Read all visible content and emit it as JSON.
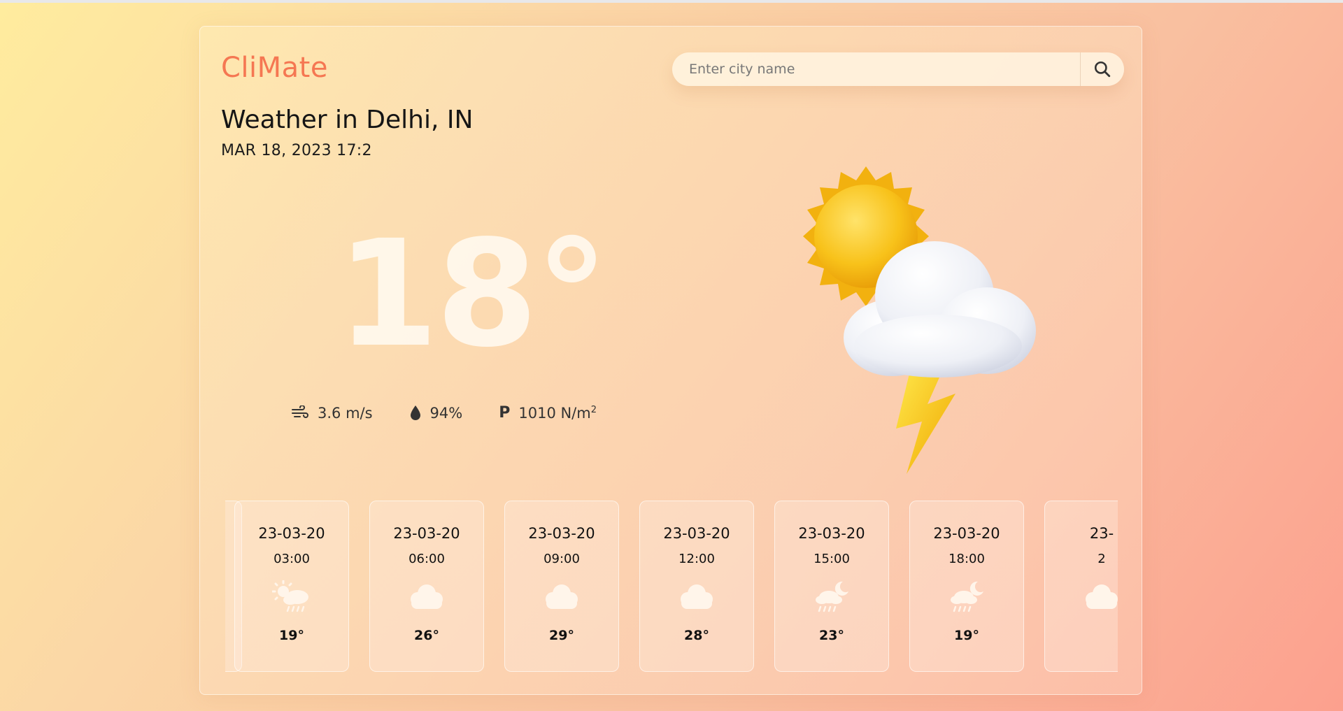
{
  "app": {
    "logo": "CliMate"
  },
  "search": {
    "placeholder": "Enter city name"
  },
  "weather": {
    "title": "Weather in Delhi, IN",
    "datetime": "MAR 18, 2023 17:2",
    "temperature": "18°",
    "wind": "3.6 m/s",
    "humidity": "94%",
    "pressure_prefix": "P",
    "pressure_value": "1010 N/m",
    "pressure_exp": "2",
    "condition_icon": "sun-cloud-thunder-icon"
  },
  "forecast": [
    {
      "date": "23-03-20",
      "time": "03:00",
      "temp": "19°",
      "icon": "sun-rain-icon"
    },
    {
      "date": "23-03-20",
      "time": "06:00",
      "temp": "26°",
      "icon": "cloud-icon"
    },
    {
      "date": "23-03-20",
      "time": "09:00",
      "temp": "29°",
      "icon": "cloud-icon"
    },
    {
      "date": "23-03-20",
      "time": "12:00",
      "temp": "28°",
      "icon": "cloud-icon"
    },
    {
      "date": "23-03-20",
      "time": "15:00",
      "temp": "23°",
      "icon": "moon-rain-icon"
    },
    {
      "date": "23-03-20",
      "time": "18:00",
      "temp": "19°",
      "icon": "moon-rain-icon"
    },
    {
      "date": "23-",
      "time": "2",
      "temp": "",
      "icon": "cloud-icon"
    }
  ],
  "colors": {
    "accent": "#f57752",
    "temperature_text": "#fff8ee"
  }
}
